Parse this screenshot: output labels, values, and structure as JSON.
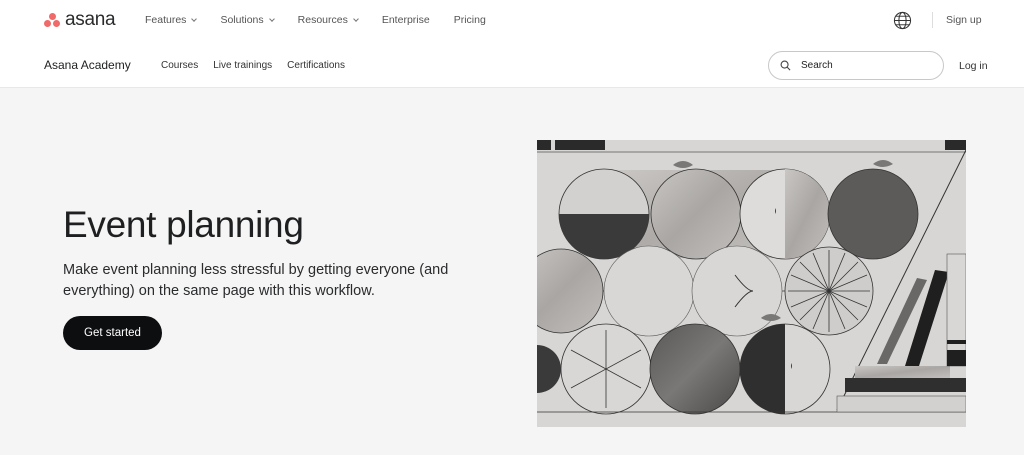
{
  "brand": {
    "name": "asana",
    "accent": "#f06a6a"
  },
  "topnav": {
    "items": [
      {
        "label": "Features",
        "dropdown": true
      },
      {
        "label": "Solutions",
        "dropdown": true
      },
      {
        "label": "Resources",
        "dropdown": true
      },
      {
        "label": "Enterprise",
        "dropdown": false
      },
      {
        "label": "Pricing",
        "dropdown": false
      }
    ],
    "signup_label": "Sign up"
  },
  "subnav": {
    "title": "Asana Academy",
    "links": [
      "Courses",
      "Live trainings",
      "Certifications"
    ],
    "search_placeholder": "Search",
    "login_label": "Log in"
  },
  "hero": {
    "title": "Event planning",
    "description": "Make event planning less stressful by getting everyone (and everything) on the same page with this workflow.",
    "cta_label": "Get started"
  },
  "colors": {
    "hero_bg": "#f5f5f5",
    "cta_bg": "#0d0e10"
  }
}
